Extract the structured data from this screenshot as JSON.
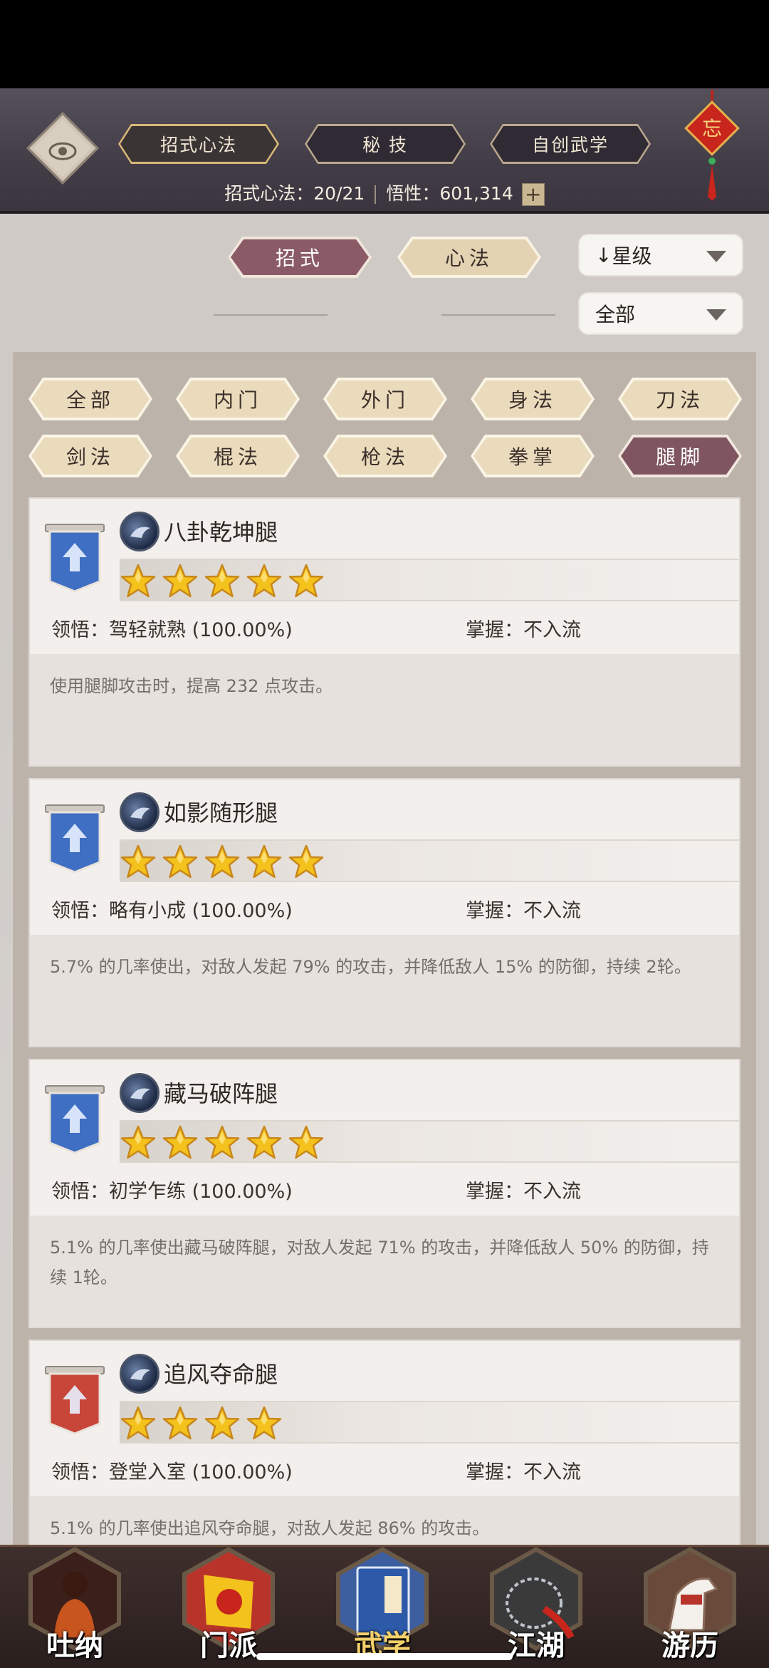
{
  "header": {
    "tabs": [
      {
        "label": "招式心法",
        "active": true
      },
      {
        "label": "秘 技",
        "active": false
      },
      {
        "label": "自创武学",
        "active": false
      }
    ],
    "stats_label": "招式心法：",
    "stats_value": "20/21",
    "insight_label": "悟性：",
    "insight_value": "601,314",
    "plus": "+",
    "knot_char": "忘"
  },
  "selector": {
    "tabs": [
      {
        "label": "招式",
        "active": true
      },
      {
        "label": "心法",
        "active": false
      }
    ],
    "sort": {
      "arrow": "↓",
      "label": "星级"
    },
    "filter": {
      "label": "全部"
    }
  },
  "filters": [
    {
      "label": "全部",
      "active": false
    },
    {
      "label": "内门",
      "active": false
    },
    {
      "label": "外门",
      "active": false
    },
    {
      "label": "身法",
      "active": false
    },
    {
      "label": "刀法",
      "active": false
    },
    {
      "label": "剑法",
      "active": false
    },
    {
      "label": "棍法",
      "active": false
    },
    {
      "label": "枪法",
      "active": false
    },
    {
      "label": "拳掌",
      "active": false
    },
    {
      "label": "腿脚",
      "active": true
    }
  ],
  "skills": [
    {
      "name": "八卦乾坤腿",
      "stars": 5,
      "banner_color": "#3f6fc2",
      "comprehension_label": "领悟：",
      "comprehension": "驾轻就熟 (100.00%)",
      "mastery_label": "掌握：",
      "mastery": "不入流",
      "description": "使用腿脚攻击时，提高 232 点攻击。"
    },
    {
      "name": "如影随形腿",
      "stars": 5,
      "banner_color": "#3f6fc2",
      "comprehension_label": "领悟：",
      "comprehension": "略有小成 (100.00%)",
      "mastery_label": "掌握：",
      "mastery": "不入流",
      "description": "5.7% 的几率使出，对敌人发起 79% 的攻击，并降低敌人 15% 的防御，持续 2轮。"
    },
    {
      "name": "藏马破阵腿",
      "stars": 5,
      "banner_color": "#3f6fc2",
      "comprehension_label": "领悟：",
      "comprehension": "初学乍练 (100.00%)",
      "mastery_label": "掌握：",
      "mastery": "不入流",
      "description": "5.1% 的几率使出藏马破阵腿，对敌人发起 71% 的攻击，并降低敌人 50% 的防御，持续 1轮。"
    },
    {
      "name": "追风夺命腿",
      "stars": 4,
      "banner_color": "#c8453a",
      "comprehension_label": "领悟：",
      "comprehension": "登堂入室 (100.00%)",
      "mastery_label": "掌握：",
      "mastery": "不入流",
      "description": "5.1% 的几率使出追风夺命腿，对敌人发起 86% 的攻击。"
    }
  ],
  "bottom_nav": [
    {
      "label": "吐纳",
      "icon": "monk-icon",
      "active": false
    },
    {
      "label": "门派",
      "icon": "flag-icon",
      "active": false
    },
    {
      "label": "武学",
      "icon": "book-icon",
      "active": true
    },
    {
      "label": "江湖",
      "icon": "net-icon",
      "active": false
    },
    {
      "label": "游历",
      "icon": "horse-icon",
      "active": false
    }
  ]
}
